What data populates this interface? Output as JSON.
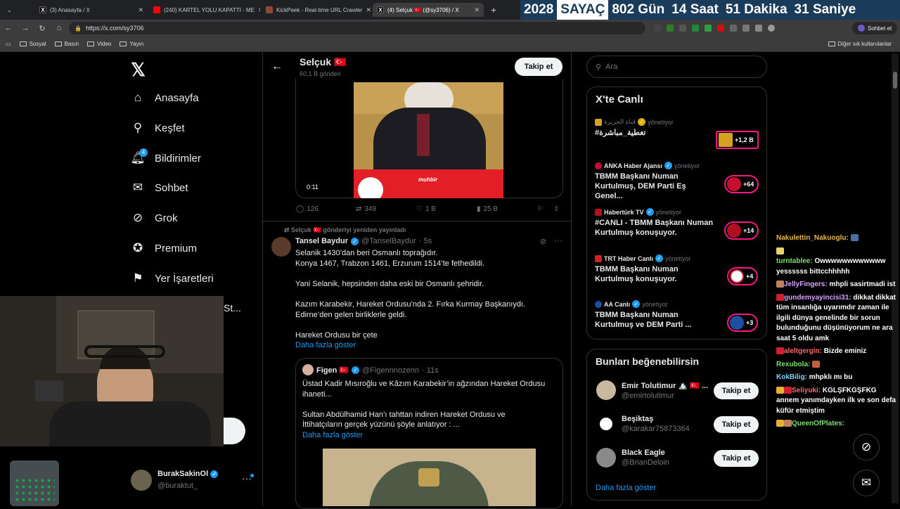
{
  "browser": {
    "tabs": [
      {
        "title": "(3) Anasayfa / X"
      },
      {
        "title": "(240) KARTEL YOLU KAPATTI - ME"
      },
      {
        "title": "KickPeek - Real-time URL Crawler"
      },
      {
        "title": "(4) Selçuk 🇹🇷 (@sy3706) / X"
      }
    ],
    "url": "https://x.com/sy3706",
    "profile_button": "Sohbet et",
    "bookmarks": [
      "Sosyal",
      "Basın",
      "Video",
      "Yayın"
    ],
    "other_bookmarks": "Diğer sık kullanılanlar"
  },
  "counter": {
    "year": "2028",
    "label": "SAYAÇ",
    "days": "802 Gün",
    "hours": "14 Saat",
    "minutes": "51 Dakika",
    "seconds": "31 Saniye"
  },
  "sidebar": {
    "items": [
      {
        "label": "Anasayfa",
        "icon": "home-icon"
      },
      {
        "label": "Keşfet",
        "icon": "search-icon"
      },
      {
        "label": "Bildirimler",
        "icon": "bell-icon",
        "badge": "4"
      },
      {
        "label": "Sohbet",
        "icon": "mail-icon"
      },
      {
        "label": "Grok",
        "icon": "grok-icon"
      },
      {
        "label": "Premium",
        "icon": "premium-icon"
      },
      {
        "label": "Yer İşaretleri",
        "icon": "bookmark-icon"
      }
    ],
    "more_partial": "St...",
    "account": {
      "name": "BurakSakinOl",
      "handle": "@buraktut_",
      "more": "···"
    }
  },
  "profile_header": {
    "name": "Selçuk 🇹🇷",
    "posts": "60,1 B gönderi",
    "follow": "Takip et"
  },
  "video_tweet": {
    "duration": "0:11",
    "banner_small": "muhbir",
    "replies": "126",
    "retweets": "349",
    "likes": "1 B",
    "views": "25 B"
  },
  "retweet": {
    "repost_label": "Selçuk 🇹🇷 gönderiyi yeniden yayınladı",
    "author": "Tansel Baydur",
    "handle": "@TanselBaydur",
    "time": "· 5s",
    "lines": [
      "Selanik 1430’dan beri Osmanlı toprağıdır.",
      "Konya 1467, Trabzon 1461, Erzurum 1514’te fethedildi.",
      "",
      "Yani Selanik, hepsinden daha eski bir Osmanlı şehridir.",
      "",
      "Kazım Karabekir, Hareket Ordusu’nda 2. Fırka Kurmay Başkanıydı.",
      "Edirne’den gelen birliklerle geldi.",
      "",
      "Hareket Ordusu bir çete"
    ],
    "show_more": "Daha fazla göster",
    "quote": {
      "author": "Figen 🇹🇷",
      "handle": "@Figennnozenn",
      "time": "· 11s",
      "lines": [
        "Üstad Kadir Mısıroğlu ve Kâzım Karabekir’in ağzından Hareket Ordusu",
        "ihaneti...",
        "",
        "Sultan Abdülhamid Han’ı tahttan indiren Hareket Ordusu ve",
        "İttihatçıların gerçek yüzünü şöyle anlatıyor : ..."
      ],
      "show_more": "Daha fazla göster"
    }
  },
  "right": {
    "search_placeholder": "Ara",
    "live_title": "X'te Canlı",
    "live": [
      {
        "source": "قناة الجزيرة",
        "role": "yönetiyor",
        "title": "#تغطية_مباشرة",
        "count": "+1,2 B",
        "color": "#d8a020"
      },
      {
        "source": "ANKA Haber Ajansı",
        "role": "yönetiyor",
        "title": "TBMM Başkanı Numan Kurtulmuş, DEM Parti Eş Genel...",
        "count": "+64",
        "color": "#c8102e"
      },
      {
        "source": "Habertürk TV",
        "role": "yönetiyor",
        "title": "#CANLI - TBMM Başkanı Numan Kurtulmuş konuşuyor.",
        "count": "+14",
        "color": "#b01020"
      },
      {
        "source": "TRT Haber Canlı",
        "role": "yönetiyor",
        "title": "TBMM Başkanı Numan Kurtulmuş konuşuyor.",
        "count": "+4",
        "color": "#d0202a"
      },
      {
        "source": "AA Canlı",
        "role": "yönetiyor",
        "title": "TBMM Başkanı Numan Kurtulmuş ve DEM Parti ...",
        "count": "+3",
        "color": "#1e4fa0"
      }
    ],
    "suggest_title": "Bunları beğenebilirsin",
    "suggestions": [
      {
        "name": "Emir Tolutimur 🏔️ 🇹🇷 ...",
        "handle": "@emirtolutimur",
        "follow": "Takip et"
      },
      {
        "name": "Beşiktaş",
        "handle": "@karakar75873364",
        "follow": "Takip et"
      },
      {
        "name": "Black Eagle",
        "handle": "@BrianDeloin",
        "follow": "Takip et"
      }
    ],
    "show_more": "Daha fazla göster"
  },
  "chat": [
    {
      "user": "Nakulettin_Nakuoglu:",
      "msg": ""
    },
    {
      "user": "turntablee:",
      "msg": "Owwwwwwwwwwww yessssss bittcchhhhh"
    },
    {
      "user": "JellyFingers:",
      "msg": "mhpli sasirtmadi ist"
    },
    {
      "user": "gundemyayincisi31:",
      "msg": "dikkat dikkat tüm insanlığa uyarımdır zaman ile ilgili dünya genelinde bir sorun bulunduğunu düşünüyorum ne ara saat 5 oldu amk"
    },
    {
      "user": "aleltgergin:",
      "msg": "Bizde eminiz"
    },
    {
      "user": "Rexubola:",
      "msg": ""
    },
    {
      "user": "KokBilig:",
      "msg": "mhpklı mı bu"
    },
    {
      "user": "Seliyuki:",
      "msg": "KGLŞFKGŞFKG annem yanımdayken ilk ve son defa küfür etmiştim"
    },
    {
      "user": "QueenOfPlates:",
      "msg": ""
    }
  ]
}
